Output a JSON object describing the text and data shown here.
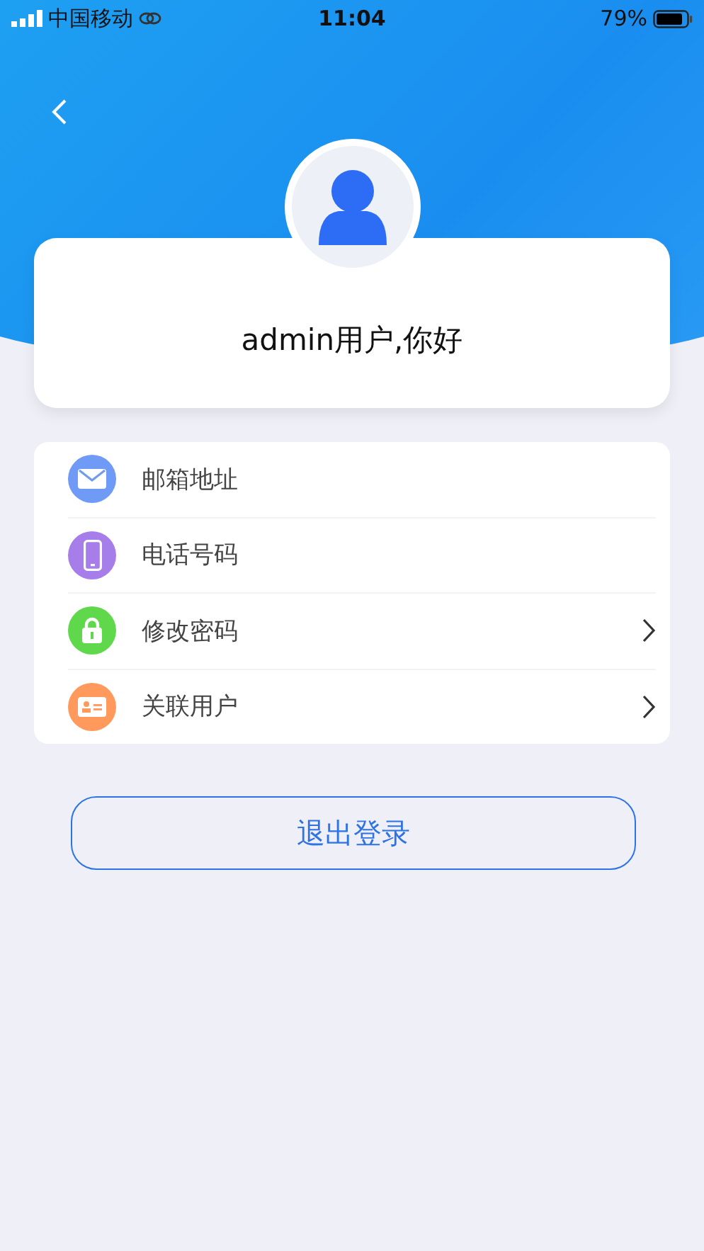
{
  "status_bar": {
    "carrier": "中国移动",
    "time": "11:04",
    "battery": "79%"
  },
  "profile": {
    "greeting": "admin用户,你好"
  },
  "menu": [
    {
      "kind": "mail",
      "label": "邮箱地址",
      "color": "#6f9af5",
      "has_arrow": false
    },
    {
      "kind": "phone",
      "label": "电话号码",
      "color": "#a77de9",
      "has_arrow": false
    },
    {
      "kind": "lock",
      "label": "修改密码",
      "color": "#5fd94b",
      "has_arrow": true
    },
    {
      "kind": "card",
      "label": "关联用户",
      "color": "#ff9a5c",
      "has_arrow": true
    }
  ],
  "logout_button": "退出登录"
}
